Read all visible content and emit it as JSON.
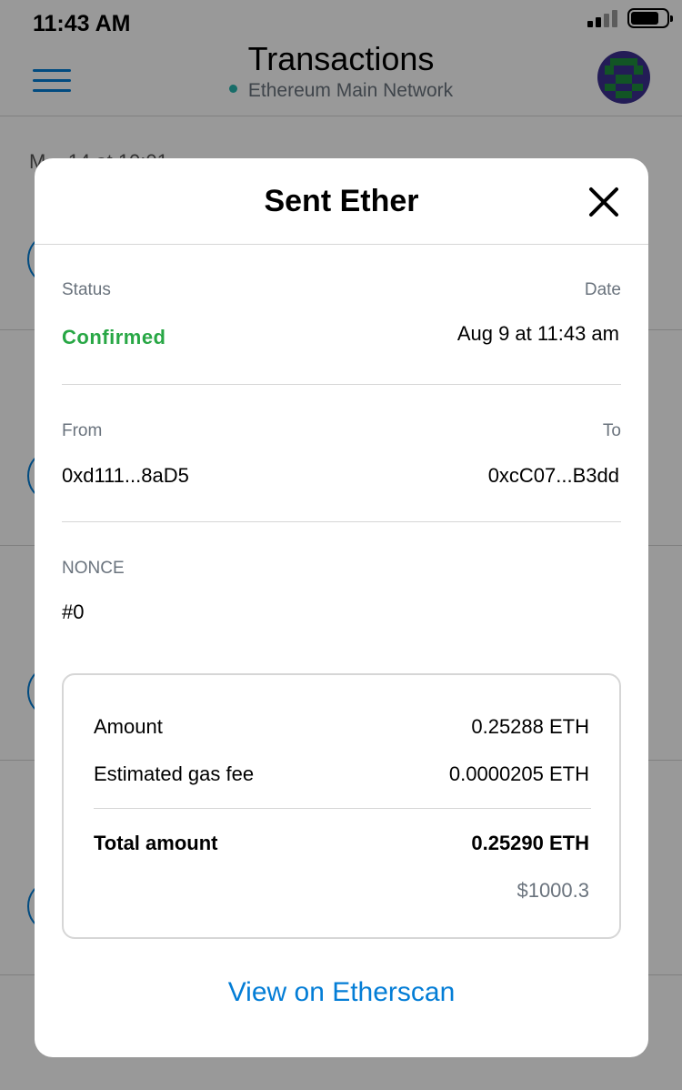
{
  "status_bar": {
    "time": "11:43 AM"
  },
  "navbar": {
    "title": "Transactions",
    "network": "Ethereum Main Network",
    "hamburger_icon": "menu-icon",
    "avatar_icon": "identicon-avatar"
  },
  "background_list": {
    "first_date_fragment": "M... 14 at 10:01 ..."
  },
  "modal": {
    "title": "Sent Ether",
    "close_icon": "close-icon",
    "status_label": "Status",
    "status_value": "Confirmed",
    "date_label": "Date",
    "date_value": "Aug 9 at 11:43 am",
    "from_label": "From",
    "from_value": "0xd111...8aD5",
    "to_label": "To",
    "to_value": "0xcC07...B3dd",
    "nonce_label": "NONCE",
    "nonce_value": "#0",
    "summary": {
      "amount_label": "Amount",
      "amount_value": "0.25288 ETH",
      "gas_label": "Estimated gas fee",
      "gas_value": "0.0000205 ETH",
      "total_label": "Total amount",
      "total_value": "0.25290 ETH",
      "fiat_value": "$1000.3"
    },
    "etherscan_link": "View on Etherscan"
  },
  "colors": {
    "accent_blue": "#037dd6",
    "confirmed_green": "#28a745",
    "muted_gray": "#6a737d",
    "divider": "#d6d6d6",
    "network_dot": "#29b6af"
  }
}
